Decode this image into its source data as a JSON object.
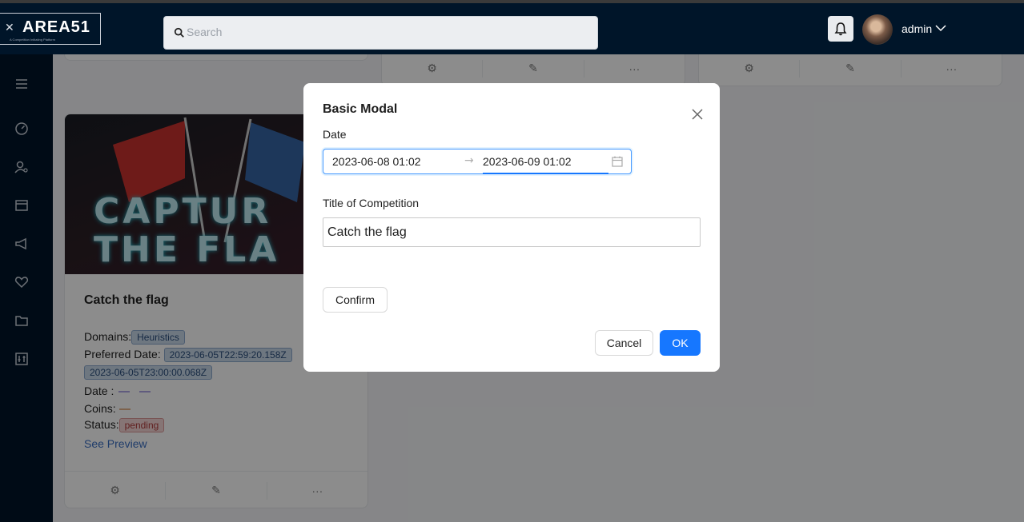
{
  "app": {
    "logo_text": "AREA51",
    "logo_tagline": "A Competition Initiating Platform",
    "search_placeholder": "Search",
    "username": "admin"
  },
  "background_card": {
    "image_text_line1": "CAPTUR",
    "image_text_line2": "THE FLA",
    "title": "Catch the flag",
    "domains_label": "Domains:",
    "domains": [
      "Heuristics"
    ],
    "preferred_date_label": "Preferred Date:",
    "preferred_dates": [
      "2023-06-05T22:59:20.158Z",
      "2023-06-05T23:00:00.068Z"
    ],
    "date_label": "Date :",
    "coins_label": "Coins:",
    "status_label": "Status:",
    "status": "pending",
    "preview_link": "See Preview"
  },
  "modal": {
    "title": "Basic Modal",
    "date_label": "Date",
    "start_date": "2023-06-08 01:02",
    "end_date": "2023-06-09 01:02",
    "competition_title_label": "Title of Competition",
    "competition_title_value": "Catch the flag",
    "confirm_label": "Confirm",
    "cancel_label": "Cancel",
    "ok_label": "OK"
  },
  "colors": {
    "header_bg": "#001529",
    "primary": "#1677ff",
    "status_pending": "#b03a3a",
    "domain_tag": "#2b4e7c"
  },
  "icons": {
    "sidebar": [
      "menu-icon",
      "dashboard-icon",
      "user-manage-icon",
      "calendar-icon",
      "announcement-icon",
      "heart-icon",
      "folder-icon",
      "settings-sliders-icon"
    ],
    "card_actions": [
      "gear-icon",
      "edit-icon",
      "ellipsis-icon"
    ]
  }
}
